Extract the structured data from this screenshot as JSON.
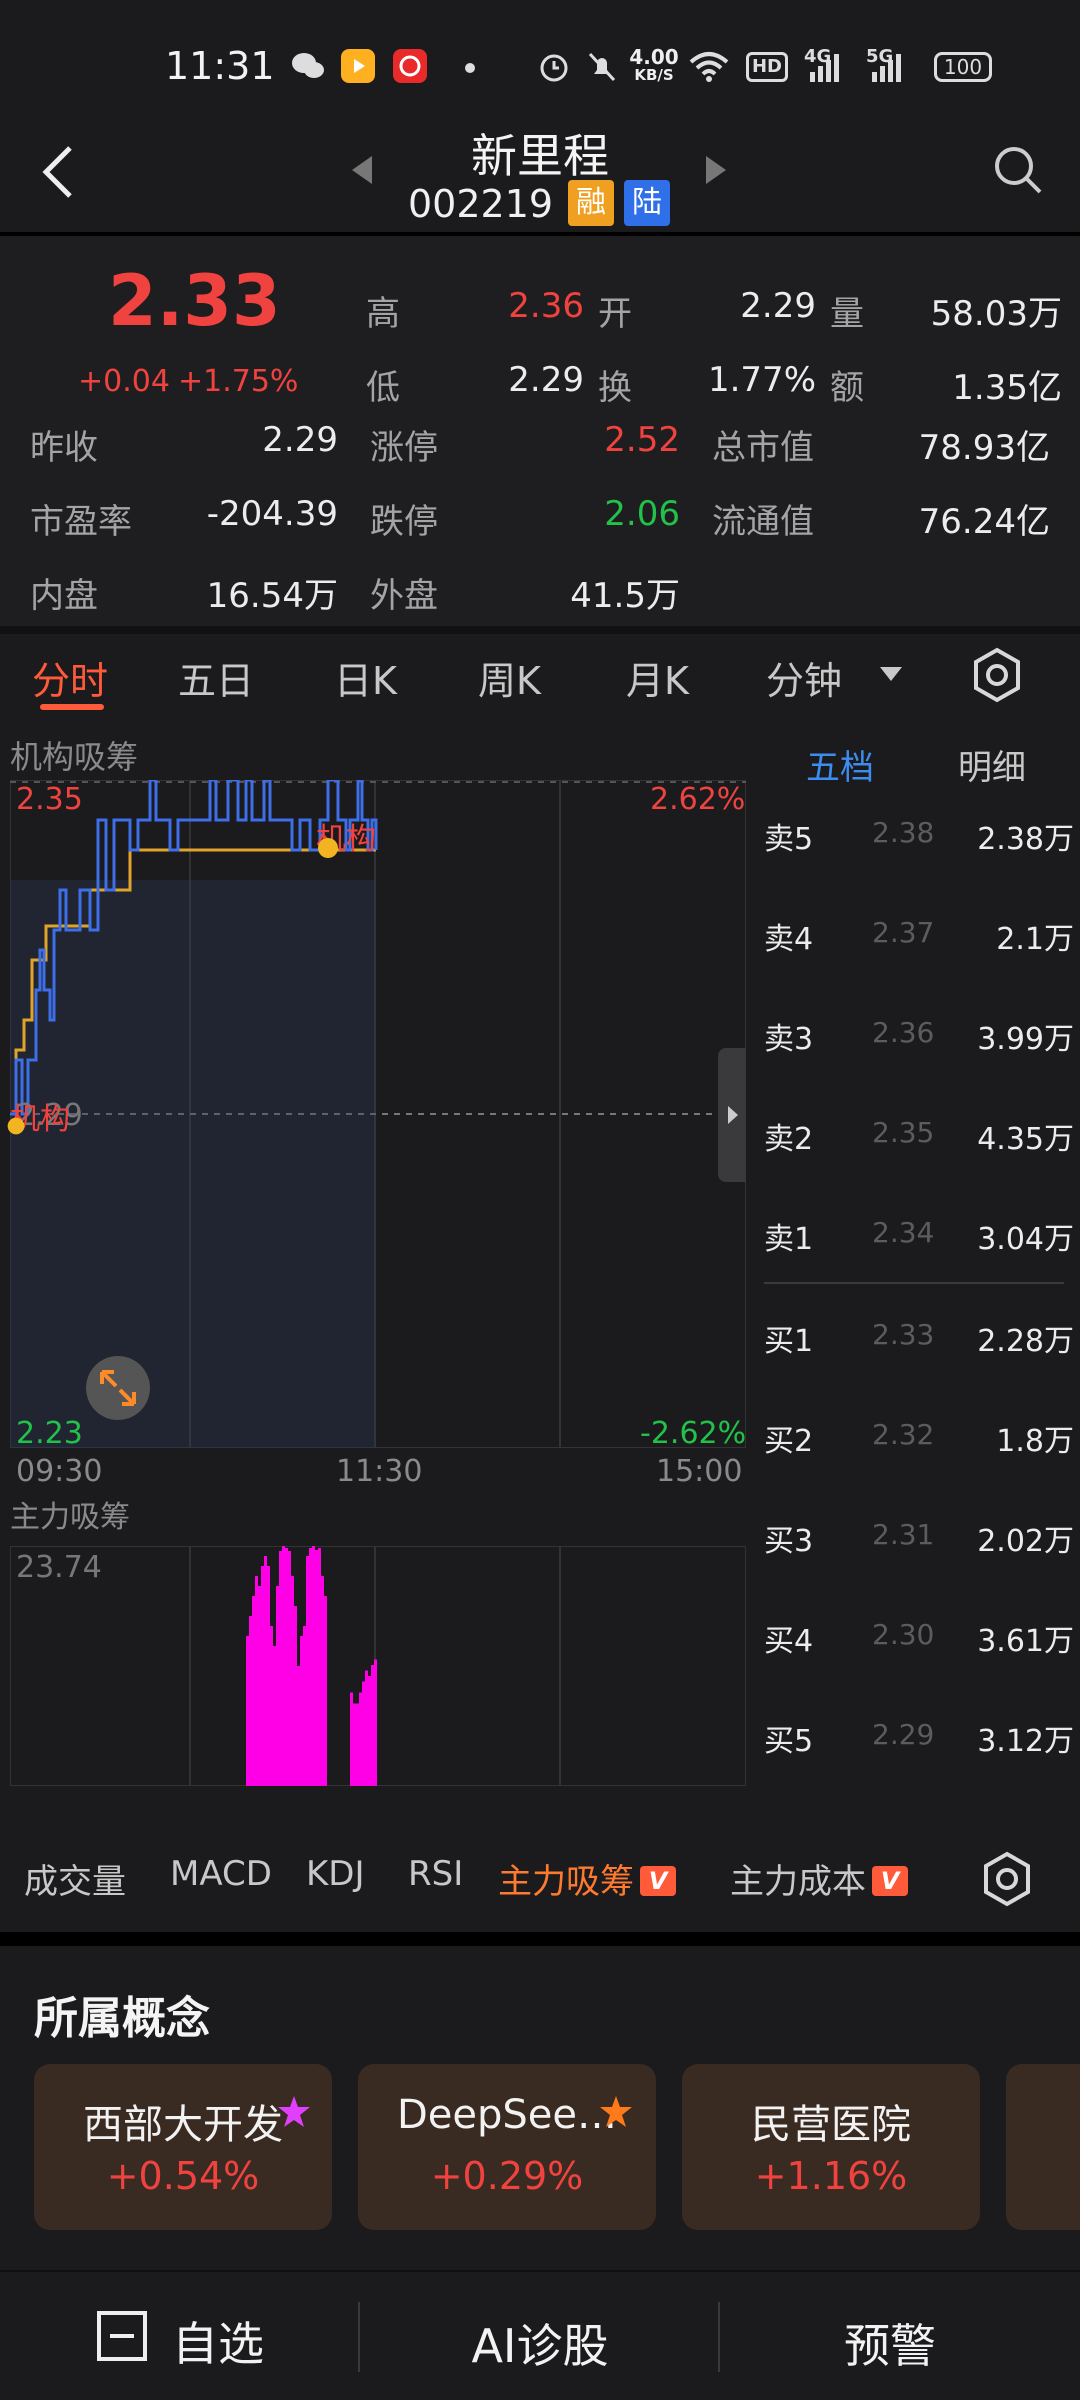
{
  "status_bar": {
    "time": "11:31",
    "net_speed": "4.00",
    "net_unit": "KB/S",
    "hd": "HD",
    "sig1": "4G",
    "sig2": "5G",
    "battery": "100"
  },
  "header": {
    "title": "新里程",
    "code": "002219",
    "tag1": "融",
    "tag2": "陆"
  },
  "quote": {
    "price": "2.33",
    "change": "+0.04",
    "change_pct": "+1.75%",
    "rows": {
      "gao_label": "高",
      "gao": "2.36",
      "kai_label": "开",
      "kai": "2.29",
      "liang_label": "量",
      "liang": "58.03万",
      "di_label": "低",
      "di": "2.29",
      "huan_label": "换",
      "huan": "1.77%",
      "e_label": "额",
      "e": "1.35亿",
      "zuoshou_label": "昨收",
      "zuoshou": "2.29",
      "zhangting_label": "涨停",
      "zhangting": "2.52",
      "zongshizhi_label": "总市值",
      "zongshizhi": "78.93亿",
      "shiying_label": "市盈率",
      "shiying": "-204.39",
      "dieting_label": "跌停",
      "dieting": "2.06",
      "liutong_label": "流通值",
      "liutong": "76.24亿",
      "neipan_label": "内盘",
      "neipan": "16.54万",
      "waipan_label": "外盘",
      "waipan": "41.5万"
    }
  },
  "tabs": [
    "分时",
    "五日",
    "日K",
    "周K",
    "月K",
    "分钟"
  ],
  "chart": {
    "title": "机构吸筹",
    "y_top": "2.35",
    "y_bottom": "2.23",
    "pct_top": "2.62%",
    "pct_bottom": "-2.62%",
    "mid_label": "2.29",
    "annot1": "机构",
    "annot2": "机构",
    "times": [
      "09:30",
      "11:30",
      "15:00"
    ]
  },
  "vol_chart": {
    "title": "主力吸筹",
    "max_label": "23.74"
  },
  "book": {
    "tab_active": "五档",
    "tab_other": "明细",
    "sell": [
      {
        "name": "卖5",
        "price": "2.38",
        "vol": "2.38万"
      },
      {
        "name": "卖4",
        "price": "2.37",
        "vol": "2.1万"
      },
      {
        "name": "卖3",
        "price": "2.36",
        "vol": "3.99万"
      },
      {
        "name": "卖2",
        "price": "2.35",
        "vol": "4.35万"
      },
      {
        "name": "卖1",
        "price": "2.34",
        "vol": "3.04万"
      }
    ],
    "buy": [
      {
        "name": "买1",
        "price": "2.33",
        "vol": "2.28万"
      },
      {
        "name": "买2",
        "price": "2.32",
        "vol": "1.8万"
      },
      {
        "name": "买3",
        "price": "2.31",
        "vol": "2.02万"
      },
      {
        "name": "买4",
        "price": "2.30",
        "vol": "3.61万"
      },
      {
        "name": "买5",
        "price": "2.29",
        "vol": "3.12万"
      }
    ]
  },
  "indicators": [
    "成交量",
    "MACD",
    "KDJ",
    "RSI",
    "主力吸筹",
    "主力成本"
  ],
  "indicator_badge": "V",
  "concepts": {
    "title": "所属概念",
    "cards": [
      {
        "name": "西部大开发",
        "chg": "+0.54%"
      },
      {
        "name": "DeepSee…",
        "chg": "+0.29%"
      },
      {
        "name": "民营医院",
        "chg": "+1.16%"
      }
    ]
  },
  "bottom": {
    "fav": "自选",
    "ai": "AI诊股",
    "alert": "预警"
  },
  "colors": {
    "up": "#f0433f",
    "down": "#22c24a",
    "accent": "#ff5a3a",
    "line": "#3d6fe8",
    "avg": "#e0a42a",
    "vol": "#ff00e6"
  }
}
